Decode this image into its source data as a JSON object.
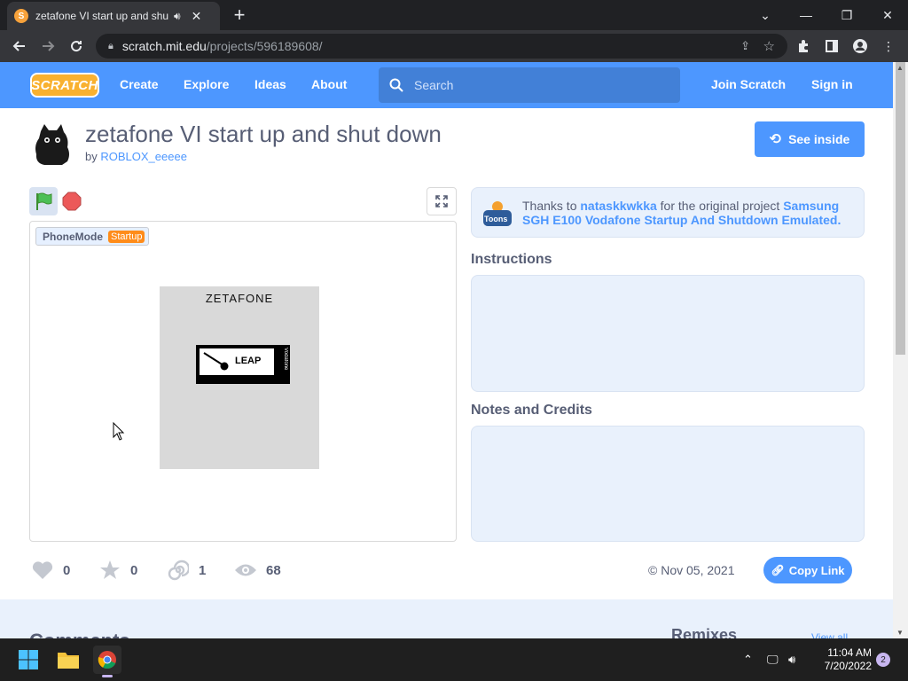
{
  "browser": {
    "tab_title": "zetafone VI start up and shut down",
    "url_host": "scratch.mit.edu",
    "url_path": "/projects/596189608/",
    "new_tab": "+",
    "minimize": "⌄",
    "window_minimize": "—",
    "window_restore": "❐",
    "window_close": "✕"
  },
  "nav": {
    "logo": "SCRATCH",
    "links": [
      "Create",
      "Explore",
      "Ideas",
      "About"
    ],
    "search_placeholder": "Search",
    "join": "Join Scratch",
    "signin": "Sign in"
  },
  "project": {
    "title": "zetafone VI start up and shut down",
    "by_prefix": "by",
    "author": "ROBLOX_eeeee",
    "see_inside": "See inside"
  },
  "stage": {
    "monitor_label": "PhoneMode",
    "monitor_value": "Startup",
    "phone_brand": "ZETAFONE",
    "logo_word": "LEAP",
    "logo_side": "Vodafone"
  },
  "credit": {
    "prefix": "Thanks to",
    "user": "nataskkwkka",
    "middle": "for the original project",
    "project": "Samsung SGH E100 Vodafone Startup And Shutdown Emulated.",
    "badge": "Toons"
  },
  "sections": {
    "instructions": "Instructions",
    "notes": "Notes and Credits"
  },
  "stats": {
    "loves": "0",
    "favorites": "0",
    "remixes": "1",
    "views": "68"
  },
  "date": "© Nov 05, 2021",
  "copy_link": "Copy Link",
  "bottom": {
    "comments": "Comments",
    "remixes": "Remixes",
    "view_all": "View all"
  },
  "taskbar": {
    "time": "11:04 AM",
    "date": "7/20/2022",
    "notifications": "2"
  },
  "colors": {
    "scratch_blue": "#4d97ff",
    "orange": "#ff8c1a",
    "text": "#575e75"
  }
}
